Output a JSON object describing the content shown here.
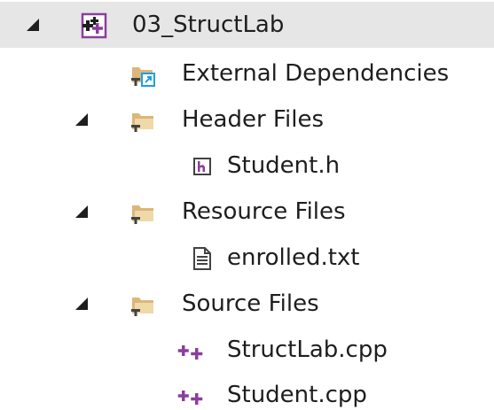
{
  "solution_explorer": {
    "project": {
      "label": "03_StructLab",
      "icon": "cpp-project-icon",
      "expanded": true,
      "children": {
        "external_dependencies": {
          "label": "External Dependencies",
          "icon": "external-dependencies-folder-icon",
          "expanded": false
        },
        "header_files": {
          "label": "Header Files",
          "icon": "filter-folder-icon",
          "expanded": true,
          "files": [
            {
              "label": "Student.h",
              "icon": "header-file-icon"
            }
          ]
        },
        "resource_files": {
          "label": "Resource Files",
          "icon": "filter-folder-icon",
          "expanded": true,
          "files": [
            {
              "label": "enrolled.txt",
              "icon": "text-file-icon"
            }
          ]
        },
        "source_files": {
          "label": "Source Files",
          "icon": "filter-folder-icon",
          "expanded": true,
          "files": [
            {
              "label": "StructLab.cpp",
              "icon": "cpp-file-icon"
            },
            {
              "label": "Student.cpp",
              "icon": "cpp-file-icon"
            }
          ]
        }
      }
    }
  },
  "colors": {
    "selection_bg": "#e6e6e6",
    "folder": "#dcb67a",
    "cpp_purple": "#8a3f9c",
    "text": "#1e1e1e"
  }
}
